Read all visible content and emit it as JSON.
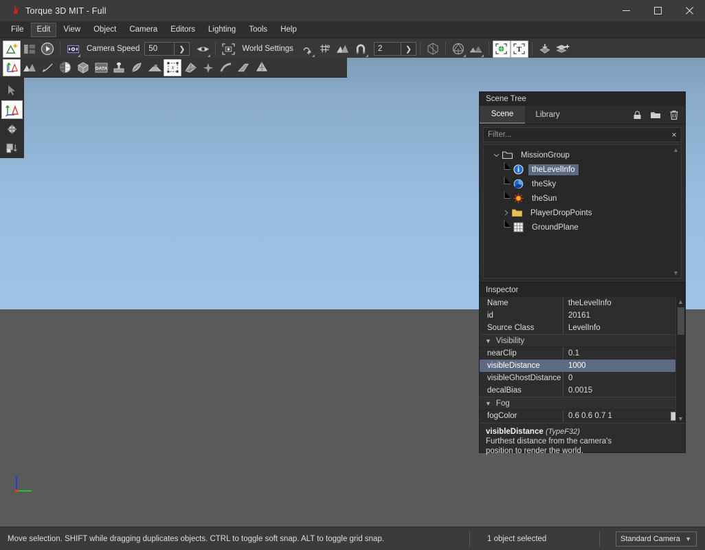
{
  "window": {
    "title": "Torque 3D MIT - Full",
    "app_icon": "torque-logo-icon",
    "minimize": "minimize-icon",
    "maximize": "maximize-icon",
    "close": "close-icon"
  },
  "menubar": {
    "items": [
      {
        "label": "File"
      },
      {
        "label": "Edit"
      },
      {
        "label": "View"
      },
      {
        "label": "Object"
      },
      {
        "label": "Camera"
      },
      {
        "label": "Editors"
      },
      {
        "label": "Lighting"
      },
      {
        "label": "Tools"
      },
      {
        "label": "Help"
      }
    ]
  },
  "toolbar_main": {
    "camera_speed_label": "Camera Speed",
    "camera_speed_value": "50",
    "camera_speed_placeholder": "50",
    "grid_size_value": "2",
    "grid_size_placeholder": "2",
    "world_settings_label": "World Settings",
    "buttons": [
      {
        "name": "world-editor-icon",
        "active": true
      },
      {
        "name": "panels-toggle-icon",
        "active": false
      },
      {
        "name": "play-icon",
        "active": false
      },
      {
        "name": "camera-view-icon",
        "active": false
      },
      {
        "name": "visibility-eye-icon",
        "active": false
      },
      {
        "name": "frame-selection-icon",
        "active": false
      },
      {
        "name": "snap-rotate-icon",
        "active": false
      },
      {
        "name": "grid-snap-icon",
        "active": false
      },
      {
        "name": "terrain-snap-icon",
        "active": false
      },
      {
        "name": "magnet-snap-icon",
        "active": false
      },
      {
        "name": "object-bounds-icon",
        "active": false
      },
      {
        "name": "orientation-cube-icon",
        "active": false
      },
      {
        "name": "terrain-render-icon",
        "active": false
      },
      {
        "name": "global-gizmo-icon",
        "active": true
      },
      {
        "name": "text-gizmo-icon",
        "active": true
      },
      {
        "name": "drop-to-ground-icon",
        "active": false
      },
      {
        "name": "duplicate-layers-icon",
        "active": false
      }
    ]
  },
  "toolbar_editors": {
    "buttons": [
      {
        "name": "object-editor-icon",
        "active": true
      },
      {
        "name": "terrain-editor-icon",
        "active": false
      },
      {
        "name": "terrain-painter-icon",
        "active": false
      },
      {
        "name": "material-editor-icon",
        "active": false
      },
      {
        "name": "shape-editor-icon",
        "active": false
      },
      {
        "name": "datablock-editor-icon",
        "active": false
      },
      {
        "name": "decal-editor-icon",
        "active": false
      },
      {
        "name": "forest-editor-icon",
        "active": false
      },
      {
        "name": "river-editor-icon",
        "active": false
      },
      {
        "name": "mesh-road-editor-icon",
        "active": true
      },
      {
        "name": "navmesh-editor-icon",
        "active": false
      },
      {
        "name": "particle-editor-icon",
        "active": false
      },
      {
        "name": "road-path-editor-icon",
        "active": false
      },
      {
        "name": "ribbon-editor-icon",
        "active": false
      },
      {
        "name": "sketch-tool-icon",
        "active": false
      }
    ]
  },
  "tool_rail": {
    "buttons": [
      {
        "name": "select-arrow-icon",
        "active": false
      },
      {
        "name": "move-gizmo-icon",
        "active": true
      },
      {
        "name": "rotate-gizmo-icon",
        "active": false
      },
      {
        "name": "scale-gizmo-icon",
        "active": false
      }
    ]
  },
  "scene_tree": {
    "title": "Scene Tree",
    "tabs": [
      {
        "label": "Scene",
        "active": true
      },
      {
        "label": "Library",
        "active": false
      }
    ],
    "header_icons": [
      {
        "name": "lock-icon"
      },
      {
        "name": "new-folder-icon"
      },
      {
        "name": "delete-trash-icon"
      }
    ],
    "filter": {
      "value": "",
      "placeholder": "Filter...",
      "clear": "×"
    },
    "nodes": [
      {
        "label": "MissionGroup",
        "depth": 0,
        "icon": "folder-open-icon",
        "twisty": "expanded",
        "selected": false
      },
      {
        "label": "theLevelInfo",
        "depth": 1,
        "icon": "info-icon",
        "twisty": "none",
        "selected": true
      },
      {
        "label": "theSky",
        "depth": 1,
        "icon": "sky-icon",
        "twisty": "none",
        "selected": false
      },
      {
        "label": "theSun",
        "depth": 1,
        "icon": "sun-icon",
        "twisty": "none",
        "selected": false
      },
      {
        "label": "PlayerDropPoints",
        "depth": 1,
        "icon": "folder-icon",
        "twisty": "collapsed",
        "selected": false
      },
      {
        "label": "GroundPlane",
        "depth": 1,
        "icon": "grid-plane-icon",
        "twisty": "last",
        "selected": false
      }
    ]
  },
  "inspector": {
    "title": "Inspector",
    "rows": [
      {
        "type": "field",
        "key": "Name",
        "value": "theLevelInfo",
        "selected": false
      },
      {
        "type": "field",
        "key": "id",
        "value": "20161",
        "selected": false
      },
      {
        "type": "field",
        "key": "Source Class",
        "value": "LevelInfo",
        "selected": false
      },
      {
        "type": "group",
        "key": "Visibility",
        "value": "",
        "selected": false
      },
      {
        "type": "field",
        "key": "nearClip",
        "value": "0.1",
        "selected": false
      },
      {
        "type": "field",
        "key": "visibleDistance",
        "value": "1000",
        "selected": true
      },
      {
        "type": "field",
        "key": "visibleGhostDistance",
        "value": "0",
        "selected": false
      },
      {
        "type": "field",
        "key": "decalBias",
        "value": "0.0015",
        "selected": false
      },
      {
        "type": "group",
        "key": "Fog",
        "value": "",
        "selected": false
      },
      {
        "type": "color",
        "key": "fogColor",
        "value": "0.6 0.6 0.7 1",
        "selected": false,
        "swatch": "#cfcfd8"
      }
    ],
    "help": {
      "name": "visibleDistance",
      "type": "(TypeF32)",
      "description_line1": "Furthest distance from the camera's",
      "description_line2": "position to render the world."
    }
  },
  "statusbar": {
    "hint": "Move selection.  SHIFT while dragging duplicates objects.  CTRL to toggle soft snap.  ALT to toggle grid snap.",
    "selection": "1 object selected",
    "camera": "Standard Camera",
    "camera_caret": "⌄"
  },
  "viewport": {
    "gizmo": "axis-gizmo",
    "sky_top_color": "#7c9cb8",
    "sky_bottom_color": "#9dc3e6",
    "ground_color": "#5b5a5a"
  }
}
